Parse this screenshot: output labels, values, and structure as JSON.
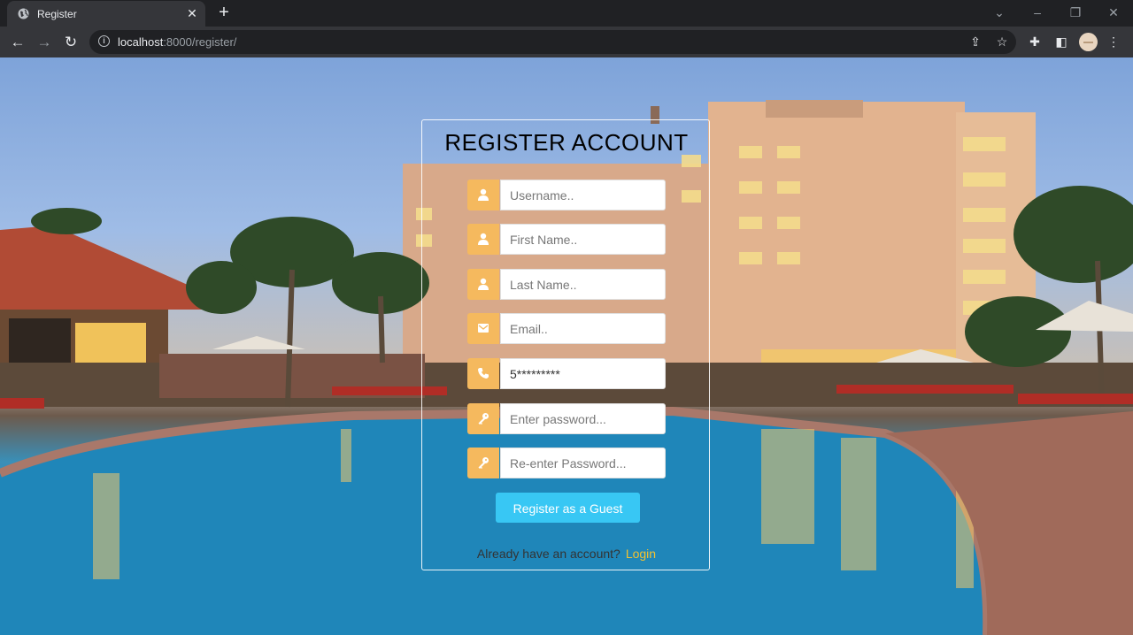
{
  "browser": {
    "tab_title": "Register",
    "url_host": "localhost",
    "url_path": ":8000/register/"
  },
  "form": {
    "heading": "REGISTER ACCOUNT",
    "fields": [
      {
        "icon": "user-icon",
        "placeholder": "Username..",
        "value": ""
      },
      {
        "icon": "user-icon",
        "placeholder": "First Name..",
        "value": ""
      },
      {
        "icon": "user-icon",
        "placeholder": "Last Name..",
        "value": ""
      },
      {
        "icon": "envelope-icon",
        "placeholder": "Email..",
        "value": ""
      },
      {
        "icon": "phone-icon",
        "placeholder": "",
        "value": "5*********"
      },
      {
        "icon": "key-icon",
        "placeholder": "Enter password...",
        "value": ""
      },
      {
        "icon": "key-icon",
        "placeholder": "Re-enter Password...",
        "value": ""
      }
    ],
    "submit_label": "Register as a Guest",
    "login_prompt": "Already have an account?",
    "login_link": "Login"
  },
  "colors": {
    "icon_bg": "#f5b95e",
    "button_bg": "#38c7f4",
    "link": "#f2c230"
  }
}
